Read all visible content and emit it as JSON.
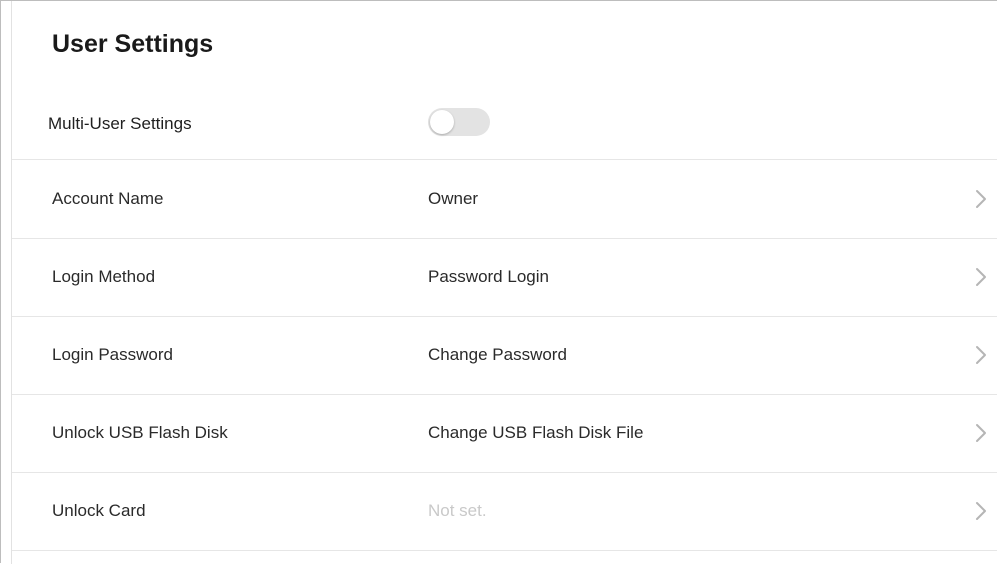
{
  "header": {
    "title": "User Settings"
  },
  "multi_user": {
    "label": "Multi-User Settings",
    "enabled": false
  },
  "rows": [
    {
      "label": "Account Name",
      "value": "Owner",
      "muted": false,
      "icon": "chevron-right-icon"
    },
    {
      "label": "Login Method",
      "value": "Password Login",
      "muted": false,
      "icon": "chevron-right-icon"
    },
    {
      "label": "Login Password",
      "value": "Change Password",
      "muted": false,
      "icon": "chevron-right-icon"
    },
    {
      "label": "Unlock USB Flash Disk",
      "value": "Change USB Flash Disk File",
      "muted": false,
      "icon": "chevron-right-icon"
    },
    {
      "label": "Unlock Card",
      "value": "Not set.",
      "muted": true,
      "icon": "chevron-right-icon"
    }
  ],
  "colors": {
    "toggle_off": "#e3e3e3",
    "chevron": "#b5b5b5",
    "muted_text": "#c9c9c9",
    "divider": "#e6e6e6"
  }
}
